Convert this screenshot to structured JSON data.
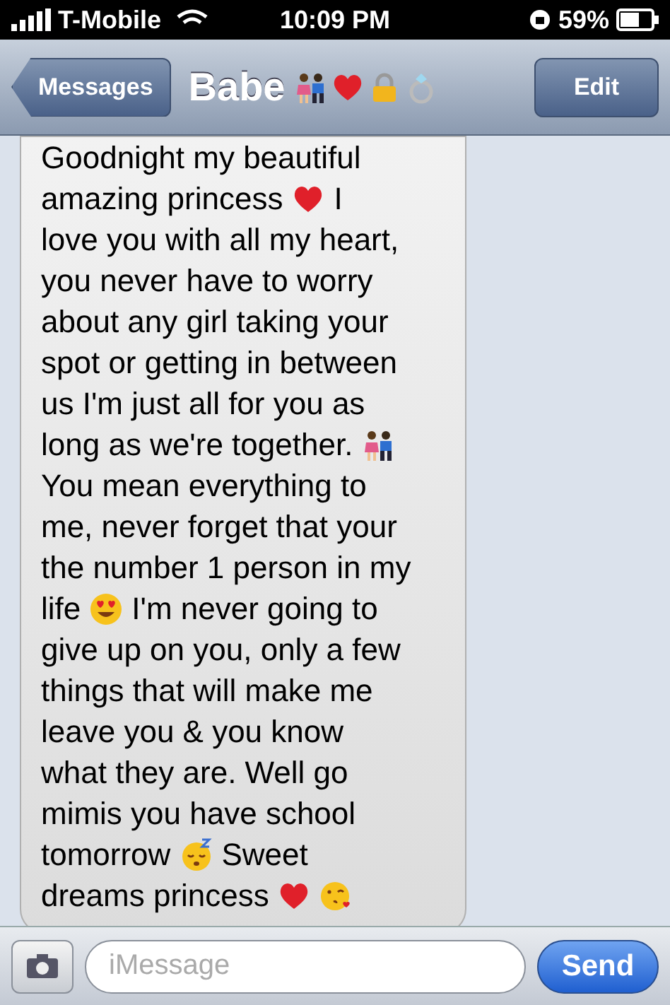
{
  "status_bar": {
    "carrier": "T-Mobile",
    "time": "10:09 PM",
    "battery": "59%"
  },
  "nav_bar": {
    "back": "Messages",
    "title": "Babe",
    "title_emoji": [
      {
        "kind": "couple"
      },
      {
        "kind": "heart"
      },
      {
        "kind": "lock"
      },
      {
        "kind": "ring"
      }
    ],
    "edit": "Edit"
  },
  "message": {
    "lines": [
      [
        {
          "kind": "text",
          "text": "Goodnight my beautiful"
        }
      ],
      [
        {
          "kind": "text",
          "text": "amazing princess"
        },
        {
          "kind": "heart"
        },
        {
          "kind": "text",
          "text": "I"
        }
      ],
      [
        {
          "kind": "text",
          "text": "love you with all my heart,"
        }
      ],
      [
        {
          "kind": "text",
          "text": "you never have to worry"
        }
      ],
      [
        {
          "kind": "text",
          "text": "about any girl taking your"
        }
      ],
      [
        {
          "kind": "text",
          "text": "spot or getting in between"
        }
      ],
      [
        {
          "kind": "text",
          "text": "us I'm just all for you as"
        }
      ],
      [
        {
          "kind": "text",
          "text": "long as we're together."
        },
        {
          "kind": "couple"
        }
      ],
      [
        {
          "kind": "text",
          "text": "You mean everything to"
        }
      ],
      [
        {
          "kind": "text",
          "text": "me, never forget that your"
        }
      ],
      [
        {
          "kind": "text",
          "text": "the number 1 person in my"
        }
      ],
      [
        {
          "kind": "text",
          "text": "life"
        },
        {
          "kind": "heart_eyes"
        },
        {
          "kind": "text",
          "text": "I'm never going to"
        }
      ],
      [
        {
          "kind": "text",
          "text": "give up on you, only a few"
        }
      ],
      [
        {
          "kind": "text",
          "text": "things that will make me"
        }
      ],
      [
        {
          "kind": "text",
          "text": "leave you & you know"
        }
      ],
      [
        {
          "kind": "text",
          "text": "what they are. Well go"
        }
      ],
      [
        {
          "kind": "text",
          "text": "mimis you have school"
        }
      ],
      [
        {
          "kind": "text",
          "text": "tomorrow"
        },
        {
          "kind": "sleepy"
        },
        {
          "kind": "text",
          "text": "Sweet"
        }
      ],
      [
        {
          "kind": "text",
          "text": "dreams princess"
        },
        {
          "kind": "heart"
        },
        {
          "kind": "kiss"
        }
      ]
    ]
  },
  "compose": {
    "placeholder": "iMessage",
    "send": "Send"
  }
}
